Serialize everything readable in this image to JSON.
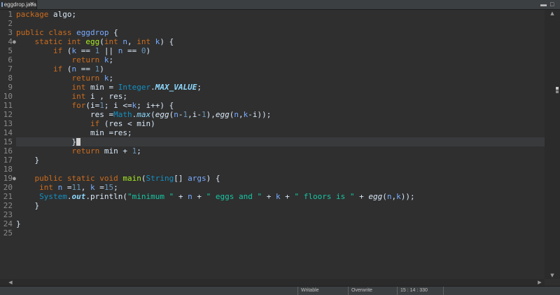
{
  "tab": {
    "title": "eggdrop.java",
    "close": "✕"
  },
  "window_controls": {
    "minimize": "▬",
    "maximize": "□"
  },
  "editor": {
    "lines": [
      {
        "n": "1",
        "fold": ""
      },
      {
        "n": "2",
        "fold": ""
      },
      {
        "n": "3",
        "fold": ""
      },
      {
        "n": "4",
        "fold": "●"
      },
      {
        "n": "5",
        "fold": ""
      },
      {
        "n": "6",
        "fold": ""
      },
      {
        "n": "7",
        "fold": ""
      },
      {
        "n": "8",
        "fold": ""
      },
      {
        "n": "9",
        "fold": ""
      },
      {
        "n": "10",
        "fold": ""
      },
      {
        "n": "11",
        "fold": ""
      },
      {
        "n": "12",
        "fold": ""
      },
      {
        "n": "13",
        "fold": ""
      },
      {
        "n": "14",
        "fold": ""
      },
      {
        "n": "15",
        "fold": ""
      },
      {
        "n": "16",
        "fold": ""
      },
      {
        "n": "17",
        "fold": ""
      },
      {
        "n": "18",
        "fold": ""
      },
      {
        "n": "19",
        "fold": "●"
      },
      {
        "n": "20",
        "fold": ""
      },
      {
        "n": "21",
        "fold": ""
      },
      {
        "n": "22",
        "fold": ""
      },
      {
        "n": "23",
        "fold": ""
      },
      {
        "n": "24",
        "fold": ""
      },
      {
        "n": "25",
        "fold": ""
      }
    ],
    "code": {
      "kw_package": "package",
      "pkg_name": " algo;",
      "kw_public": "public",
      "kw_class": "class",
      "class_name": "eggdrop",
      "brace_open": " {",
      "kw_static": "static",
      "kw_int": "int",
      "m_egg": "egg",
      "param_n": "n",
      "param_k": "k",
      "kw_if": "if",
      "kw_return": "return",
      "kw_for": "for",
      "str_min": "\"minimum \"",
      "str_eggs": "\" eggs and \"",
      "str_floors": "\" floors is \"",
      "type_integer": "Integer",
      "const_max": "MAX_VALUE",
      "type_math": "Math",
      "m_max": "max",
      "kw_void": "void",
      "m_main": "main",
      "type_string": "String",
      "p_args": "args",
      "type_system": "System",
      "field_out": "out",
      "m_println": "println",
      "num_0": "0",
      "num_1": "1",
      "num_11": "11",
      "num_15": "15",
      "var_min": "min",
      "var_i": "i",
      "var_res": "res"
    }
  },
  "status": {
    "writable": "Writable",
    "mode": "Overwrite",
    "position": "15 : 14 : 330"
  }
}
